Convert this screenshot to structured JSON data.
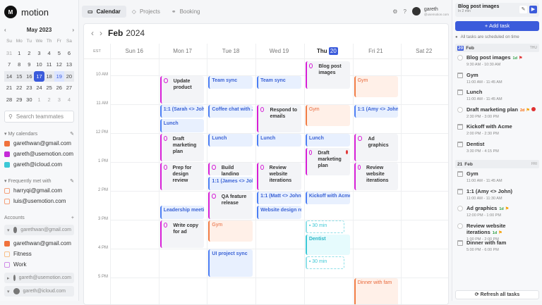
{
  "app": {
    "name": "motion",
    "logo_letters": "M"
  },
  "mini_calendar": {
    "month": "May 2023",
    "dow": [
      "Su",
      "Mo",
      "Tu",
      "We",
      "Th",
      "Fr",
      "Sa"
    ],
    "weeks": [
      [
        "31",
        "1",
        "2",
        "3",
        "4",
        "5",
        "6"
      ],
      [
        "7",
        "8",
        "9",
        "10",
        "11",
        "12",
        "13"
      ],
      [
        "14",
        "15",
        "16",
        "17",
        "18",
        "19",
        "20"
      ],
      [
        "21",
        "22",
        "23",
        "24",
        "25",
        "26",
        "27"
      ],
      [
        "28",
        "29",
        "30",
        "1",
        "2",
        "3",
        "4"
      ]
    ],
    "selected": "17",
    "today": "19"
  },
  "search": {
    "placeholder": "Search teammates"
  },
  "my_calendars": {
    "label": "My calendars",
    "items": [
      {
        "label": "garethwan@gmail.com",
        "color": "#f0723c"
      },
      {
        "label": "gareth@usemotion.com",
        "color": "#c52ad8"
      },
      {
        "label": "gareth@icloud.com",
        "color": "#3cc8d6"
      }
    ]
  },
  "frequently_met": {
    "label": "Frequently met with",
    "items": [
      {
        "label": "harryqi@gmail.com",
        "color": "#f4a07a"
      },
      {
        "label": "luis@usemotion.com",
        "color": "#f4a07a"
      }
    ]
  },
  "accounts": {
    "label": "Accounts",
    "groups": [
      {
        "label": "garethwan@gmail.com",
        "items": [
          {
            "label": "garethwan@gmail.com",
            "color": "#f0723c",
            "filled": true
          },
          {
            "label": "Fitness",
            "color": "#f7c08a",
            "filled": false
          },
          {
            "label": "Work",
            "color": "#d08be8",
            "filled": false
          }
        ]
      },
      {
        "label": "gareth@usemotion.com"
      },
      {
        "label": "gareth@icloud.com"
      }
    ]
  },
  "nav": {
    "tabs": [
      "Calendar",
      "Projects",
      "Booking"
    ],
    "user_name": "gareth",
    "user_email": "@usemotion.com"
  },
  "calendar": {
    "month": "Feb",
    "year": "2024",
    "timezone": "EST",
    "days": [
      {
        "label": "Sun 16"
      },
      {
        "label": "Mon 17"
      },
      {
        "label": "Tue 18"
      },
      {
        "label": "Wed 19"
      },
      {
        "label": "Thu",
        "num": "20",
        "current": true
      },
      {
        "label": "Fri 21"
      },
      {
        "label": "Sat 22"
      }
    ],
    "hours": [
      {
        "label": "10 AM",
        "h": 10
      },
      {
        "label": "11 AM",
        "h": 11
      },
      {
        "label": "12 PM",
        "h": 12
      },
      {
        "label": "1 PM",
        "h": 13
      },
      {
        "label": "2 PM",
        "h": 14
      },
      {
        "label": "3 PM",
        "h": 15
      },
      {
        "label": "4 PM",
        "h": 16
      },
      {
        "label": "5 PM",
        "h": 17
      }
    ],
    "events": [
      {
        "day": 1,
        "start": 10,
        "end": 11,
        "title": "Update product",
        "kind": "task"
      },
      {
        "day": 1,
        "start": 11,
        "end": 11.5,
        "title": "1:1 (Sarah <> John)",
        "kind": "meeting"
      },
      {
        "day": 1,
        "start": 11.5,
        "end": 12,
        "title": "Lunch",
        "kind": "meeting"
      },
      {
        "day": 1,
        "start": 12,
        "end": 13,
        "title": "Draft marketing plan",
        "kind": "task"
      },
      {
        "day": 1,
        "start": 13,
        "end": 14,
        "title": "Prep for design review",
        "kind": "task"
      },
      {
        "day": 1,
        "start": 14.5,
        "end": 15,
        "title": "Leadership meeting",
        "kind": "meeting"
      },
      {
        "day": 1,
        "start": 15,
        "end": 16,
        "title": "Write copy for ad",
        "kind": "task"
      },
      {
        "day": 2,
        "start": 10,
        "end": 10.5,
        "title": "Team sync",
        "kind": "meeting"
      },
      {
        "day": 2,
        "start": 11,
        "end": 11.5,
        "title": "Coffee chat with J",
        "kind": "meeting"
      },
      {
        "day": 2,
        "start": 12,
        "end": 12.5,
        "title": "Lunch",
        "kind": "meeting"
      },
      {
        "day": 2,
        "start": 13,
        "end": 13.5,
        "title": "Build landing page",
        "kind": "task"
      },
      {
        "day": 2,
        "start": 13.5,
        "end": 14,
        "title": "1:1 (James <> John)",
        "kind": "meeting"
      },
      {
        "day": 2,
        "start": 14,
        "end": 15,
        "title": "QA feature release",
        "kind": "task"
      },
      {
        "day": 2,
        "start": 15,
        "end": 15.8,
        "title": "Gym",
        "kind": "personal"
      },
      {
        "day": 2,
        "start": 16,
        "end": 17,
        "title": "UI project sync",
        "kind": "meeting"
      },
      {
        "day": 3,
        "start": 10,
        "end": 10.5,
        "title": "Team sync",
        "kind": "meeting"
      },
      {
        "day": 3,
        "start": 11,
        "end": 12,
        "title": "Respond to emails",
        "kind": "task"
      },
      {
        "day": 3,
        "start": 12,
        "end": 12.5,
        "title": "Lunch",
        "kind": "meeting"
      },
      {
        "day": 3,
        "start": 13,
        "end": 14,
        "title": "Review website iterations",
        "kind": "task"
      },
      {
        "day": 3,
        "start": 14,
        "end": 14.5,
        "title": "1:1 (Matt <> John)",
        "kind": "meeting"
      },
      {
        "day": 3,
        "start": 14.5,
        "end": 15,
        "title": "Website design review",
        "kind": "meeting"
      },
      {
        "day": 4,
        "start": 9.5,
        "end": 10.5,
        "title": "Blog post images",
        "kind": "task"
      },
      {
        "day": 4,
        "start": 11,
        "end": 11.8,
        "title": "Gym",
        "kind": "personal"
      },
      {
        "day": 4,
        "start": 12,
        "end": 12.5,
        "title": "Lunch",
        "kind": "meeting"
      },
      {
        "day": 4,
        "start": 12.5,
        "end": 13.5,
        "title": "Draft marketing plan",
        "kind": "task",
        "error": true
      },
      {
        "day": 4,
        "start": 14,
        "end": 14.5,
        "title": "Kickoff with Acme",
        "kind": "meeting"
      },
      {
        "day": 4,
        "start": 15,
        "end": 15.5,
        "title": "30 min",
        "kind": "travel"
      },
      {
        "day": 4,
        "start": 15.5,
        "end": 16.25,
        "title": "Dentist",
        "kind": "cyan"
      },
      {
        "day": 4,
        "start": 16.25,
        "end": 16.75,
        "title": "30 min",
        "kind": "travel"
      },
      {
        "day": 5,
        "start": 10,
        "end": 10.8,
        "title": "Gym",
        "kind": "personal"
      },
      {
        "day": 5,
        "start": 11,
        "end": 11.5,
        "title": "1:1 (Amy <> John)",
        "kind": "meeting"
      },
      {
        "day": 5,
        "start": 12,
        "end": 13,
        "title": "Ad graphics",
        "kind": "task"
      },
      {
        "day": 5,
        "start": 13,
        "end": 14,
        "title": "Review website iterations",
        "kind": "task"
      },
      {
        "day": 5,
        "start": 17,
        "end": 18,
        "title": "Dinner with fam",
        "kind": "personal"
      }
    ]
  },
  "right_panel": {
    "current_task": {
      "title": "Blog post images",
      "subtitle": "In 2 min"
    },
    "add_task": "Add task",
    "status": "All tasks are scheduled on time",
    "days": [
      {
        "num": "20",
        "month": "Feb",
        "dow": "THU",
        "today": true,
        "tasks": [
          {
            "title": "Blog post images",
            "time": "9:30 AM - 10:30 AM",
            "type": "task",
            "due": "1d",
            "due_color": "#2f9e44",
            "flag": "#e03131"
          },
          {
            "title": "Gym",
            "time": "11:00 AM - 11:45 AM",
            "type": "event"
          },
          {
            "title": "Lunch",
            "time": "11:00 AM - 11:45 AM",
            "type": "event"
          },
          {
            "title": "Draft marketing plan",
            "time": "2:30 PM - 3:00 PM",
            "type": "task",
            "due": "2d",
            "due_color": "#f76707",
            "flag": "#f59f00",
            "error": true
          },
          {
            "title": "Kickoff with Acme",
            "time": "2:00 PM - 2:30 PM",
            "type": "event"
          },
          {
            "title": "Dentist",
            "time": "3:30 PM - 4:15 PM",
            "type": "event"
          }
        ]
      },
      {
        "num": "21",
        "month": "Feb",
        "dow": "FRI",
        "today": false,
        "tasks": [
          {
            "title": "Gym",
            "time": "11:00 AM - 11:45 AM",
            "type": "event"
          },
          {
            "title": "1:1 (Amy <> John)",
            "time": "11:00 AM - 11:30 AM",
            "type": "event"
          },
          {
            "title": "Ad graphics",
            "time": "12:00 PM - 1:00 PM",
            "type": "task",
            "due": "1d",
            "due_color": "#2f9e44",
            "flag": "#f59f00"
          },
          {
            "title": "Review website iterations",
            "time": "1:00 PM - 2:00 PM",
            "type": "task",
            "due": "1d",
            "due_color": "#2f9e44",
            "flag": "#f59f00"
          },
          {
            "title": "Dinner with fam",
            "time": "5:00 PM - 6:00 PM",
            "type": "event"
          }
        ]
      }
    ],
    "refresh": "Refresh all tasks"
  }
}
